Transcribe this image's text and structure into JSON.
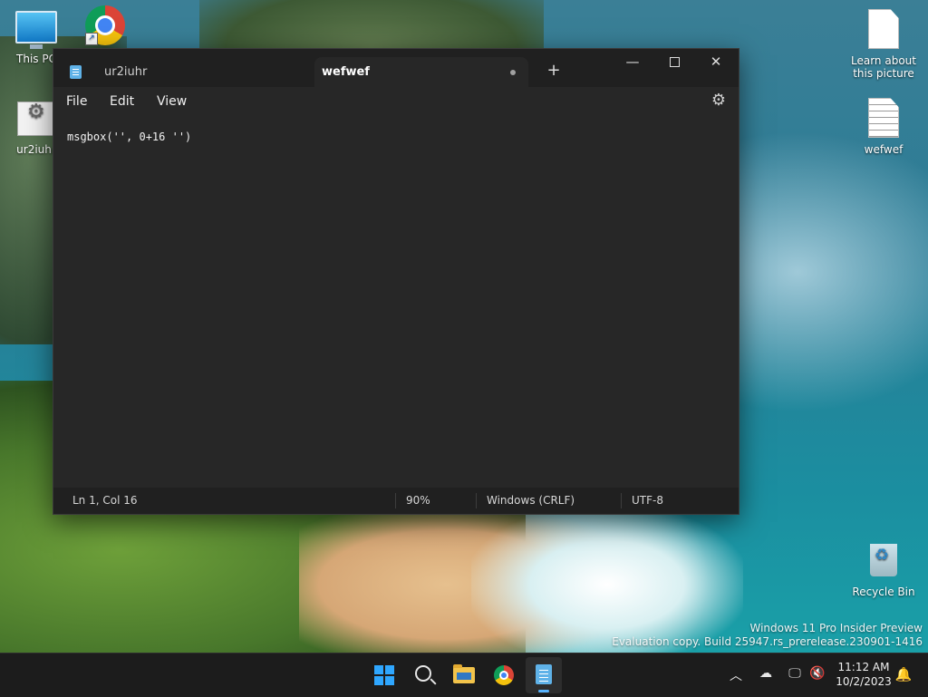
{
  "desktop": {
    "icons": [
      {
        "label": "This PC"
      },
      {
        "label": "ur2iuhr"
      },
      {
        "label": "Learn about this picture"
      },
      {
        "label": "wefwef"
      },
      {
        "label": "Recycle Bin"
      }
    ],
    "watermark": {
      "line1": "Windows 11 Pro Insider Preview",
      "line2": "Evaluation copy. Build 25947.rs_prerelease.230901-1416"
    }
  },
  "notepad": {
    "tabs": [
      {
        "label": "ur2iuhr",
        "active": false
      },
      {
        "label": "wefwef",
        "active": true,
        "modified": true
      }
    ],
    "new_tab_symbol": "+",
    "controls": {
      "minimize": "—",
      "close": "✕"
    },
    "menu": {
      "file": "File",
      "edit": "Edit",
      "view": "View"
    },
    "editor_text": "msgbox('', 0+16 '')",
    "status": {
      "position": "Ln 1, Col 16",
      "zoom": "90%",
      "line_ending": "Windows (CRLF)",
      "encoding": "UTF-8"
    },
    "icons": {
      "settings": "gear-icon",
      "app": "notepad-icon"
    }
  },
  "taskbar": {
    "apps": [
      "start",
      "search",
      "file-explorer",
      "chrome",
      "notepad"
    ],
    "active_app": "notepad",
    "clock": {
      "time": "11:12 AM",
      "date": "10/2/2023"
    },
    "accent_color": "#58b4ff"
  }
}
